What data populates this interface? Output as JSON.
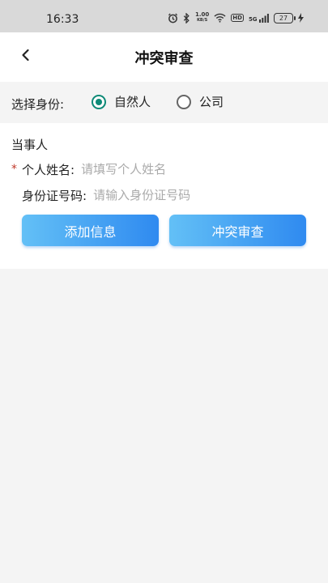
{
  "status_bar": {
    "time": "16:33",
    "network_speed": "1.00",
    "network_unit": "KB/S",
    "hd": "HD",
    "signal_type": "5G",
    "battery": "27"
  },
  "header": {
    "title": "冲突审查"
  },
  "identity": {
    "label": "选择身份:",
    "options": [
      {
        "label": "自然人",
        "checked": true
      },
      {
        "label": "公司",
        "checked": false
      }
    ],
    "accent_color": "#0e8a77"
  },
  "form": {
    "section_title": "当事人",
    "required_mark": "*",
    "name_label": "个人姓名:",
    "name_placeholder": "请填写个人姓名",
    "id_label": "身份证号码:",
    "id_placeholder": "请输入身份证号码"
  },
  "buttons": {
    "add": "添加信息",
    "check": "冲突审查",
    "gradient": [
      "#63c0f6",
      "#2f8af0"
    ]
  }
}
